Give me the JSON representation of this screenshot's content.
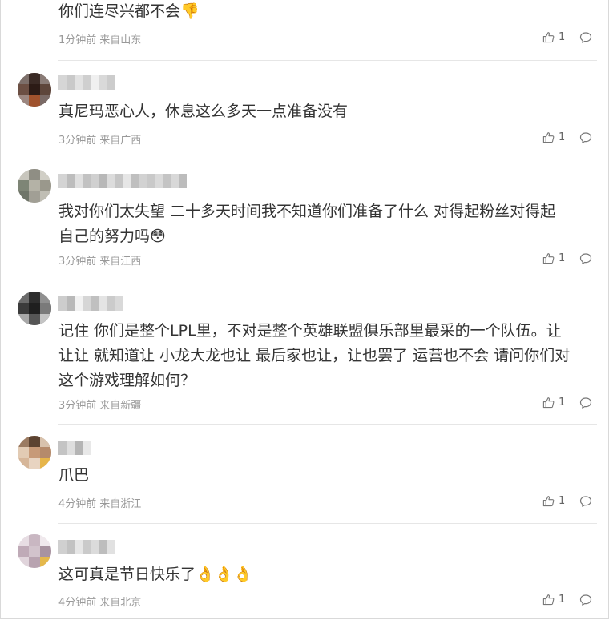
{
  "comments": [
    {
      "text": "你们连尽兴都不会👎",
      "time": "1分钟前",
      "location": "来自山东",
      "likes": "1",
      "has_user": false
    },
    {
      "text": "真尼玛恶心人，休息这么多天一点准备没有",
      "time": "3分钟前",
      "location": "来自广西",
      "likes": "1",
      "has_user": true
    },
    {
      "text": "我对你们太失望 二十多天时间我不知道你们准备了什么 对得起粉丝对得起\n自己的努力吗😳",
      "time": "3分钟前",
      "location": "来自江西",
      "likes": "1",
      "has_user": true
    },
    {
      "text": "记住 你们是整个LPL里，不对是整个英雄联盟俱乐部里最采的一个队伍。让\n让让 就知道让 小龙大龙也让 最后家也让，让也罢了 运营也不会 请问你们对\n这个游戏理解如何？",
      "time": "3分钟前",
      "location": "来自新疆",
      "likes": "1",
      "has_user": true
    },
    {
      "text": "爪巴",
      "time": "4分钟前",
      "location": "来自浙江",
      "likes": "1",
      "has_user": true
    },
    {
      "text": "这可真是节日快乐了👌👌👌",
      "time": "4分钟前",
      "location": "来自北京",
      "likes": "1",
      "has_user": true
    }
  ],
  "icons": {
    "like": "thumbs-up-icon",
    "reply": "comment-bubble-icon"
  },
  "colors": {
    "meta": "#999999",
    "text": "#333333",
    "divider": "#e6e6e6"
  }
}
